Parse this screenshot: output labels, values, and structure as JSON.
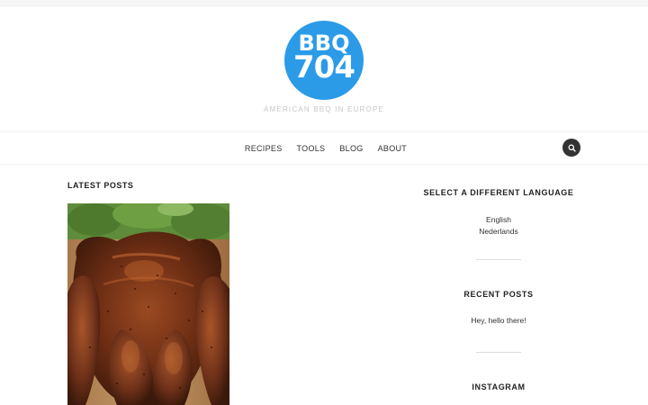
{
  "site": {
    "logo_line1": "BBQ",
    "logo_line2": "704",
    "tagline": "AMERICAN BBQ IN EUROPE",
    "brand_color": "#2b9be8"
  },
  "nav": {
    "items": [
      {
        "label": "RECIPES"
      },
      {
        "label": "TOOLS"
      },
      {
        "label": "BLOG"
      },
      {
        "label": "ABOUT"
      }
    ],
    "search_icon": "search-icon"
  },
  "main": {
    "latest_posts_title": "LATEST POSTS",
    "featured_image": "grilled-spatchcock-chicken-photo"
  },
  "sidebar": {
    "language_widget": {
      "title": "SELECT A DIFFERENT LANGUAGE",
      "languages": [
        "English",
        "Nederlands"
      ]
    },
    "recent_posts_widget": {
      "title": "RECENT POSTS",
      "posts": [
        "Hey, hello there!"
      ]
    },
    "instagram_widget": {
      "title": "INSTAGRAM"
    }
  }
}
